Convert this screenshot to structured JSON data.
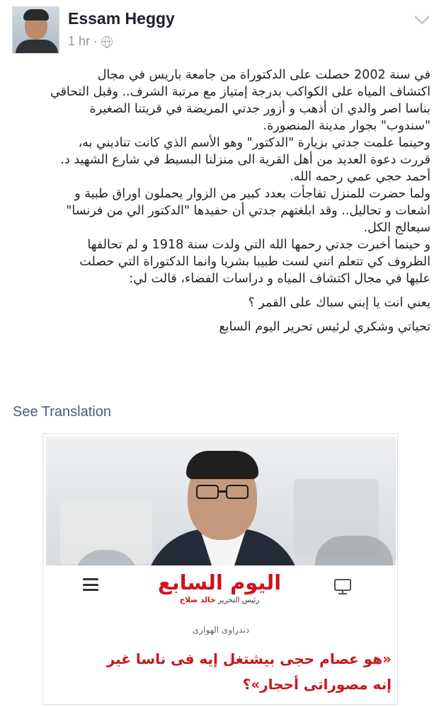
{
  "author": {
    "name": "Essam Heggy",
    "timestamp": "1 hr",
    "separator": "·",
    "privacy_icon": "globe-icon",
    "menu_icon": "chevron-down-icon"
  },
  "post": {
    "lines": [
      "في سنة 2002 حصلت على الدكتوراة من جامعة باريس في مجال",
      "اكتشاف المياه على الكواكب بدرجة إمتياز مع مرتبة الشرف.. وقبل التحاقي",
      "بناسا اصر والدي ان أذهب و أزور جدتي المريضة في قريتنا الصغيرة",
      "\"سندوب\" بجوار مدينة المنصورة.",
      "وحينما علمت جدتي بزيارة \"الدكتور\" وهو الأسم الذي كانت تناديني به،",
      "قررت دعوة العديد من أهل القرية الى منزلنا البسيط في شارع الشهيد د.",
      "أحمد حجي عمي رحمه الله.",
      "ولما حضرت للمنزل تفاجأت بعدد كبير من الزوار يحملون اوراق طبية و",
      "اشعات و تحاليل.. وقد ابلغتهم جدتي أن حفيدها \"الدكتور الي من فرنسا\"",
      "سيعالج الكل.",
      "و حينما أخبرت جدتي رحمها الله التي ولدت سنة 1918 و لم تحالفها",
      "الظروف كي تتعلم انني لست طبيبا بشريا وانما الدكتوراة التي حصلت",
      "عليها في مجال اكتشاف المياه و دراسات الفضاء، قالت لي:"
    ],
    "quote": "يعني انت يا إبني سباك على القمر ؟",
    "closing": "تحياتي وشكري لرئيس تحرير اليوم السابع"
  },
  "see_translation": "See Translation",
  "shared_card": {
    "logo_text": "اليوم السابع",
    "editor_label": "رئيس التحرير",
    "editor_name": "خالد صلاح",
    "menu_icon": "hamburger-menu-icon",
    "desktop_icon": "monitor-icon",
    "byline": "دندراوى الهوارى",
    "headline_lines": [
      "«هو عصام حجى بيشتغل إيه فى ناسا غير",
      "إنه مصوراتى أحجار»؟"
    ],
    "accent_color": "#d0121b"
  }
}
